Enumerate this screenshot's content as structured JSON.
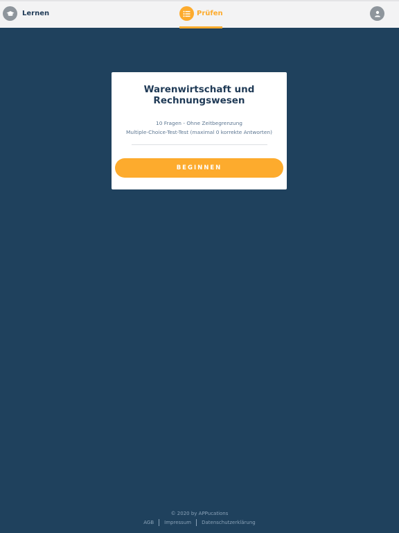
{
  "header": {
    "learn_label": "Lernen",
    "exam_label": "Prüfen",
    "learn_icon": "graduation-cap-icon",
    "exam_icon": "list-icon",
    "profile_icon": "user-icon"
  },
  "card": {
    "title": "Warenwirtschaft und Rechnungswesen",
    "subtitle_line1": "10 Fragen - Ohne Zeitbegrenzung",
    "subtitle_line2": "Multiple-Choice-Test-Test (maximal 0 korrekte Antworten)",
    "start_label": "BEGINNEN"
  },
  "footer": {
    "copyright": "© 2020 by APPucations",
    "links": [
      "AGB",
      "Impressum",
      "Datenschutzerklärung"
    ]
  },
  "colors": {
    "background": "#1f415d",
    "accent": "#fdab2d",
    "topbar": "#f3f3f4",
    "title_text": "#1f3a56"
  }
}
